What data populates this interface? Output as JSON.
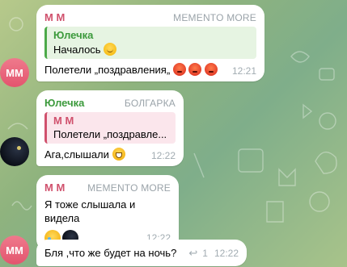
{
  "messages": [
    {
      "sender": "М М",
      "rank": "MEMENTO MORE",
      "reply": {
        "name": "Юлечка",
        "text": "Началось"
      },
      "text": "Полетели „поздравления„",
      "time": "12:21",
      "avatar_initials": "MM"
    },
    {
      "sender": "Юлечка",
      "rank": "БОЛГАРКА",
      "reply": {
        "name": "М М",
        "text": "Полетели „поздравле..."
      },
      "text": "Ага,слышали",
      "time": "12:22"
    },
    {
      "sender": "М М",
      "rank": "MEMENTO MORE",
      "text": "Я тоже слышала и видела",
      "time": "12:22",
      "reactions": [
        "crying-face-reaction",
        "user-avatar-reaction"
      ]
    },
    {
      "text": "Бля ,что же будет на ночь?",
      "reply_count": "1",
      "time": "12:22",
      "avatar_initials": "MM"
    }
  ],
  "colors": {
    "mm_name": "#d0516d",
    "yul_name": "#3c9a3c",
    "time": "#a2acb2"
  }
}
